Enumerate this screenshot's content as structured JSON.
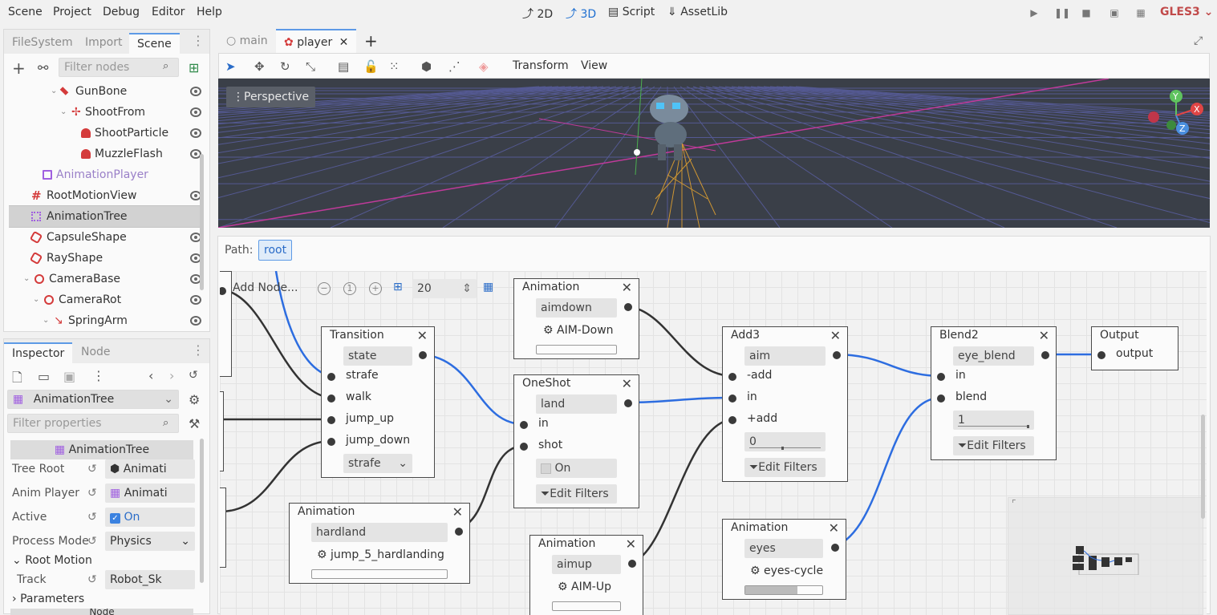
{
  "menubar": {
    "items": [
      "Scene",
      "Project",
      "Debug",
      "Editor",
      "Help"
    ],
    "workspaces": [
      {
        "label": "2D",
        "active": false
      },
      {
        "label": "3D",
        "active": true
      },
      {
        "label": "Script",
        "active": false
      },
      {
        "label": "AssetLib",
        "active": false
      }
    ],
    "renderer": "GLES3"
  },
  "dock_top": {
    "tabs": [
      "FileSystem",
      "Import",
      "Scene"
    ],
    "active_tab": "Scene",
    "filter_placeholder": "Filter nodes",
    "tree": [
      {
        "label": "GunBone",
        "icon": "bone-icon",
        "visible": true
      },
      {
        "label": "ShootFrom",
        "icon": "position3d-icon",
        "visible": true
      },
      {
        "label": "ShootParticle",
        "icon": "particles-icon",
        "visible": true
      },
      {
        "label": "MuzzleFlash",
        "icon": "particles-icon",
        "visible": true
      },
      {
        "label": "AnimationPlayer",
        "icon": "animation-player-icon",
        "visible": false
      },
      {
        "label": "RootMotionView",
        "icon": "root-motion-icon",
        "visible": true
      },
      {
        "label": "AnimationTree",
        "icon": "animation-tree-icon",
        "visible": false
      },
      {
        "label": "CapsuleShape",
        "icon": "collision-shape-icon",
        "visible": true
      },
      {
        "label": "RayShape",
        "icon": "collision-shape-icon",
        "visible": true
      },
      {
        "label": "CameraBase",
        "icon": "spatial-icon",
        "visible": true
      },
      {
        "label": "CameraRot",
        "icon": "spatial-icon",
        "visible": true
      },
      {
        "label": "SpringArm",
        "icon": "spring-arm-icon",
        "visible": true
      }
    ]
  },
  "dock_bottom": {
    "tabs": [
      "Inspector",
      "Node"
    ],
    "active_tab": "Inspector",
    "object": "AnimationTree",
    "filter_placeholder": "Filter properties",
    "section_title": "AnimationTree",
    "props": [
      {
        "name": "Tree Root",
        "value": "Animati"
      },
      {
        "name": "Anim Player",
        "value": "Animati"
      },
      {
        "name": "Active",
        "value": "On"
      },
      {
        "name": "Process Mode",
        "value": "Physics"
      }
    ],
    "root_motion": "Root Motion",
    "track_name": "Track",
    "track_value": "Robot_Sk",
    "parameters": "Parameters",
    "node_label": "Node"
  },
  "scene_tabs": [
    {
      "label": "main",
      "active": false
    },
    {
      "label": "player",
      "active": true
    }
  ],
  "viewport_toolbar": {
    "menus": [
      "Transform",
      "View"
    ]
  },
  "viewport": {
    "perspective": "Perspective"
  },
  "blend_panel": {
    "path_label": "Path:",
    "path_root": "root",
    "add_node": "Add Node...",
    "snap": "20"
  },
  "nodes": {
    "transition": {
      "title": "Transition",
      "field": "state",
      "ports": [
        "strafe",
        "walk",
        "jump_up",
        "jump_down"
      ],
      "current": "strafe"
    },
    "anim_aimdown": {
      "title": "Animation",
      "field": "aimdown",
      "anim": "AIM-Down"
    },
    "oneshot": {
      "title": "OneShot",
      "field": "land",
      "ports": [
        "in",
        "shot"
      ],
      "toggle": "On",
      "filters": "Edit Filters"
    },
    "anim_hardland": {
      "title": "Animation",
      "field": "hardland",
      "anim": "jump_5_hardlanding"
    },
    "anim_aimup": {
      "title": "Animation",
      "field": "aimup",
      "anim": "AIM-Up"
    },
    "add3": {
      "title": "Add3",
      "field": "aim",
      "ports": [
        "-add",
        "in",
        "+add"
      ],
      "amount": "0",
      "filters": "Edit Filters"
    },
    "anim_eyes": {
      "title": "Animation",
      "field": "eyes",
      "anim": "eyes-cycle"
    },
    "blend2": {
      "title": "Blend2",
      "field": "eye_blend",
      "ports": [
        "in",
        "blend"
      ],
      "amount": "1",
      "filters": "Edit Filters"
    },
    "output": {
      "title": "Output",
      "port": "output"
    }
  },
  "colors": {
    "accent": "#5d9ae6",
    "connection_blue": "#2d6de0",
    "connection_dark": "#333333"
  }
}
